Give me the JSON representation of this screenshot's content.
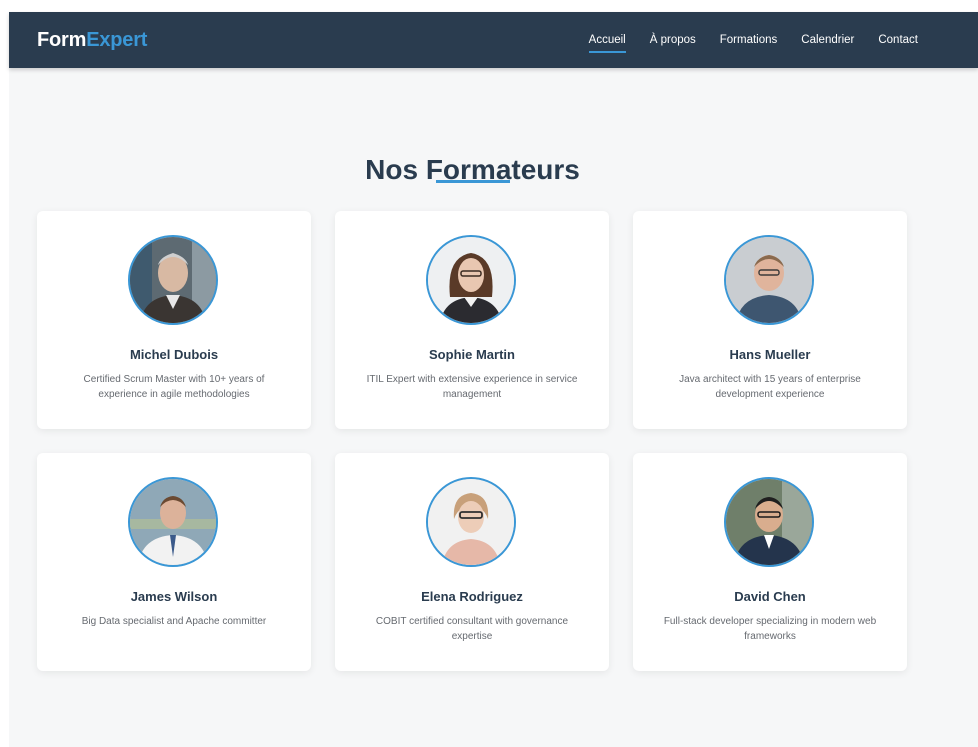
{
  "brand": {
    "part1": "Form",
    "part2": "Expert",
    "color_primary": "#ffffff",
    "color_accent": "#3a97d6"
  },
  "nav": {
    "items": [
      {
        "label": "Accueil",
        "active": true
      },
      {
        "label": "À propos",
        "active": false
      },
      {
        "label": "Formations",
        "active": false
      },
      {
        "label": "Calendrier",
        "active": false
      },
      {
        "label": "Contact",
        "active": false
      }
    ]
  },
  "section": {
    "title": "Nos Formateurs"
  },
  "trainers": [
    {
      "name": "Michel Dubois",
      "description": "Certified Scrum Master with 10+ years of experience in agile methodologies",
      "photo_icon": "trainer-photo-icon"
    },
    {
      "name": "Sophie Martin",
      "description": "ITIL Expert with extensive experience in service management",
      "photo_icon": "trainer-photo-icon"
    },
    {
      "name": "Hans Mueller",
      "description": "Java architect with 15 years of enterprise development experience",
      "photo_icon": "trainer-photo-icon"
    },
    {
      "name": "James Wilson",
      "description": "Big Data specialist and Apache committer",
      "photo_icon": "trainer-photo-icon"
    },
    {
      "name": "Elena Rodriguez",
      "description": "COBIT certified consultant with governance expertise",
      "photo_icon": "trainer-photo-icon"
    },
    {
      "name": "David Chen",
      "description": "Full-stack developer specializing in modern web frameworks",
      "photo_icon": "trainer-photo-icon"
    }
  ],
  "colors": {
    "navbar_bg": "#2a3c4f",
    "accent": "#3a97d6",
    "heading": "#2a3c4f",
    "text_muted": "#666a70",
    "page_bg": "#f6f7f8"
  }
}
